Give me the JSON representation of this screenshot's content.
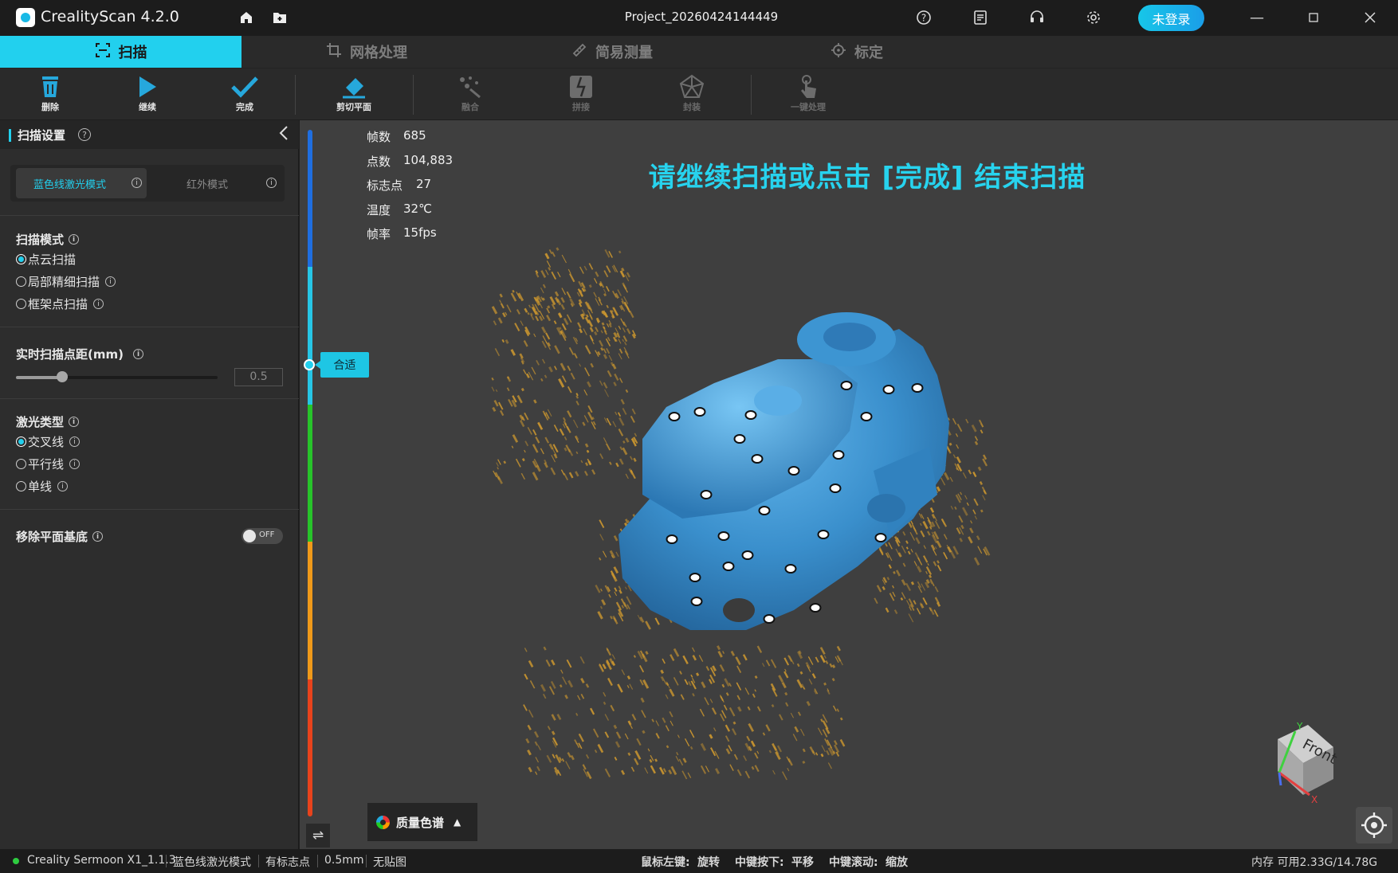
{
  "app": {
    "title": "CrealityScan 4.2.0",
    "project": "Project_20260424144449",
    "login_label": "未登录"
  },
  "tabs": [
    {
      "label": "扫描",
      "active": true
    },
    {
      "label": "网格处理",
      "active": false
    },
    {
      "label": "简易测量",
      "active": false
    },
    {
      "label": "标定",
      "active": false
    }
  ],
  "toolbar": {
    "delete": "删除",
    "continue": "继续",
    "finish": "完成",
    "cut_plane": "剪切平面",
    "fuse": "融合",
    "stitch": "拼接",
    "encap": "封装",
    "one_click": "一键处理"
  },
  "sidebar": {
    "title": "扫描设置",
    "mode_blue": "蓝色线激光模式",
    "mode_ir": "红外模式",
    "scan_mode": {
      "title": "扫描模式",
      "options": [
        "点云扫描",
        "局部精细扫描",
        "框架点扫描"
      ],
      "selected": 0
    },
    "point_dist": {
      "title": "实时扫描点距(mm)",
      "value": "0.5",
      "fraction": 0.23
    },
    "laser_type": {
      "title": "激光类型",
      "options": [
        "交叉线",
        "平行线",
        "单线"
      ],
      "selected": 0
    },
    "remove_plane": {
      "title": "移除平面基底",
      "state": "OFF"
    }
  },
  "viewport": {
    "stats": [
      {
        "k": "帧数",
        "v": "685"
      },
      {
        "k": "点数",
        "v": "104,883"
      },
      {
        "k": "标志点",
        "v": "27"
      },
      {
        "k": "温度",
        "v": "32℃"
      },
      {
        "k": "帧率",
        "v": "15fps"
      }
    ],
    "headline": "请继续扫描或点击 [完成] 结束扫描",
    "fit_label": "合适",
    "palette_label": "质量色谱",
    "cube": {
      "face": "Front",
      "x": "X",
      "y": "Y"
    },
    "colors": {
      "accent": "#22d0ee",
      "model": "#3a95cf",
      "pointcloud": "#c9952f"
    }
  },
  "status": {
    "device": "Creality Sermoon X1_1.1.3",
    "mode": "蓝色线激光模式",
    "marker": "有标志点",
    "dist": "0.5mm",
    "texture": "无贴图",
    "left_key": "鼠标左键:",
    "left_action": "旋转",
    "mid_press": "中键按下:",
    "mid_press_action": "平移",
    "mid_scroll": "中键滚动:",
    "mid_scroll_action": "缩放",
    "memory": "内存 可用2.33G/14.78G"
  }
}
